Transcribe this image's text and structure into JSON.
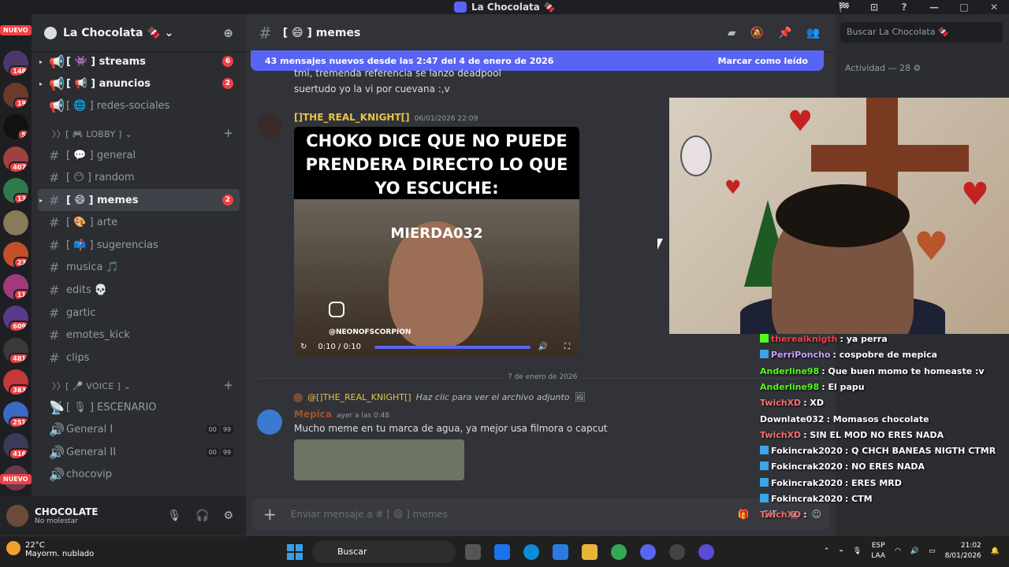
{
  "window": {
    "title": "La Chocolata 🍫",
    "controls": [
      "🏁",
      "⊡",
      "?",
      "—",
      "□",
      "✕"
    ]
  },
  "servers": {
    "nuevo_top": "NUEVO",
    "nuevo_bottom": "NUEVO",
    "items": [
      {
        "badge": "148",
        "color": "#4a3a6a"
      },
      {
        "badge": "19",
        "color": "#6b3a2a"
      },
      {
        "badge": "5",
        "color": "#111111"
      },
      {
        "badge": "407",
        "color": "#a04040"
      },
      {
        "badge": "13",
        "color": "#2f7a4a"
      },
      {
        "badge": "",
        "color": "#8a7a5a"
      },
      {
        "badge": "23",
        "color": "#c4502a"
      },
      {
        "badge": "11",
        "color": "#a03a7a"
      },
      {
        "badge": "609",
        "color": "#5a3a8a"
      },
      {
        "badge": "481",
        "color": "#3a3a3a"
      },
      {
        "badge": "383",
        "color": "#c43a3a"
      },
      {
        "badge": "251",
        "color": "#3a6ac4"
      },
      {
        "badge": "416",
        "color": "#3a3a5a"
      },
      {
        "badge": "",
        "color": "#6a3a4a"
      }
    ]
  },
  "guild": {
    "name": "La Chocolata 🍫 ⌄"
  },
  "channels": [
    {
      "label": "[ 👾 ] streams",
      "badge": "6",
      "unread": true
    },
    {
      "label": "[ 📢 ] anuncios",
      "badge": "2",
      "unread": true
    },
    {
      "label": "[ 🌐 ] redes-sociales",
      "badge": "",
      "unread": false
    },
    {
      "label": "[ 💬 ] general",
      "badge": "",
      "unread": false
    },
    {
      "label": "[ 😶 ] random",
      "badge": "",
      "unread": false
    },
    {
      "label": "[ 😄 ] memes",
      "badge": "2",
      "unread": true
    },
    {
      "label": "[ 🎨 ] arte",
      "badge": "",
      "unread": false
    },
    {
      "label": "[ 📫 ] sugerencias",
      "badge": "",
      "unread": false
    },
    {
      "label": "musica 🎵",
      "badge": "",
      "unread": false
    },
    {
      "label": "edits 💀",
      "badge": "",
      "unread": false
    },
    {
      "label": "gartic",
      "badge": "",
      "unread": false
    },
    {
      "label": "emotes_kick",
      "badge": "",
      "unread": false
    },
    {
      "label": "clips",
      "badge": "",
      "unread": false
    },
    {
      "label": "[ 🎙 ] ESCENARIO",
      "badge": "",
      "unread": false
    },
    {
      "label": "General I",
      "vc": [
        "00",
        "99"
      ]
    },
    {
      "label": "General II",
      "vc": [
        "00",
        "99"
      ]
    },
    {
      "label": "chocovip",
      "badge": "",
      "unread": false
    }
  ],
  "categories": {
    "lobby": "〉〉[ 🎮 LOBBY ] ⌄",
    "voice": "〉〉[ 🎤 VOICE ] ⌄"
  },
  "user": {
    "name": "CHOCOLATE",
    "status": "No molestar"
  },
  "header": {
    "channel": "[ 😄 ] memes"
  },
  "newbar": {
    "text": "43 mensajes nuevos desde las 2:47 del 4 de enero de 2026",
    "action": "Marcar como leído"
  },
  "messages": {
    "prev1": "tmi, tremenda referencia se lanzo deadpool",
    "prev2": "suertudo yo la vi por cuevana :,v",
    "knight": {
      "author": "[]THE_REAL_KNIGHT[]",
      "time": "06/01/2026 22:09"
    },
    "video": {
      "caption": "CHOKO DICE QUE NO PUEDE PRENDERA DIRECTO LO QUE YO ESCUCHE:",
      "overlay": "MIERDA032",
      "handle": "@NEONOFSCORPION",
      "time": "0:10 / 0:10",
      "progress": 1.0
    },
    "date_divider": "7 de enero de 2026",
    "reply": {
      "mention": "@[]THE_REAL_KNIGHT[]",
      "text": "Haz clic para ver el archivo adjunto"
    },
    "mepica": {
      "author": "Mepica",
      "time": "ayer a las 0:48",
      "text": "Mucho meme en tu marca de agua, ya mejor usa filmora o capcut"
    }
  },
  "input": {
    "placeholder": "Enviar mensaje a # [ 😄 ] memes"
  },
  "right": {
    "search": "Buscar La Chocolata 🍫",
    "activity": "Actividad — 28 ⚙"
  },
  "stream_chat": [
    {
      "user": "therealknigth",
      "msg": ": ya perra",
      "color": "#f23f43",
      "badge": "kick"
    },
    {
      "user": "PerriPoncho",
      "msg": ": cospobre de mepica",
      "color": "#c8a0ff",
      "badge": "kb"
    },
    {
      "user": "Anderline98",
      "msg": ": Que buen momo te homeaste :v",
      "color": "#53fc18",
      "badge": ""
    },
    {
      "user": "Anderline98",
      "msg": ": El papu",
      "color": "#53fc18",
      "badge": ""
    },
    {
      "user": "TwichXD",
      "msg": ": XD",
      "color": "#ff6b6b",
      "badge": ""
    },
    {
      "user": "Downlate032",
      "msg": ": Momasos chocolate",
      "color": "#ffffff",
      "badge": ""
    },
    {
      "user": "TwichXD",
      "msg": ": SIN EL MOD NO ERES NADA",
      "color": "#ff6b6b",
      "badge": ""
    },
    {
      "user": "Fokincrak2020",
      "msg": ": Q CHCH BANEAS NIGTH CTMR",
      "color": "#ffffff",
      "badge": "kb"
    },
    {
      "user": "Fokincrak2020",
      "msg": ": NO ERES NADA",
      "color": "#ffffff",
      "badge": "kb"
    },
    {
      "user": "Fokincrak2020",
      "msg": ": ERES MRD",
      "color": "#ffffff",
      "badge": "kb"
    },
    {
      "user": "Fokincrak2020",
      "msg": ": CTM",
      "color": "#ffffff",
      "badge": "kb"
    },
    {
      "user": "TwichXD",
      "msg": ":",
      "color": "#ff6b6b",
      "badge": ""
    }
  ],
  "taskbar": {
    "temp": "22°C",
    "weather": "Mayorm. nublado",
    "search": "Buscar",
    "lang": "ESP",
    "region": "LAA",
    "time": "21:02",
    "date": "8/01/2026"
  }
}
